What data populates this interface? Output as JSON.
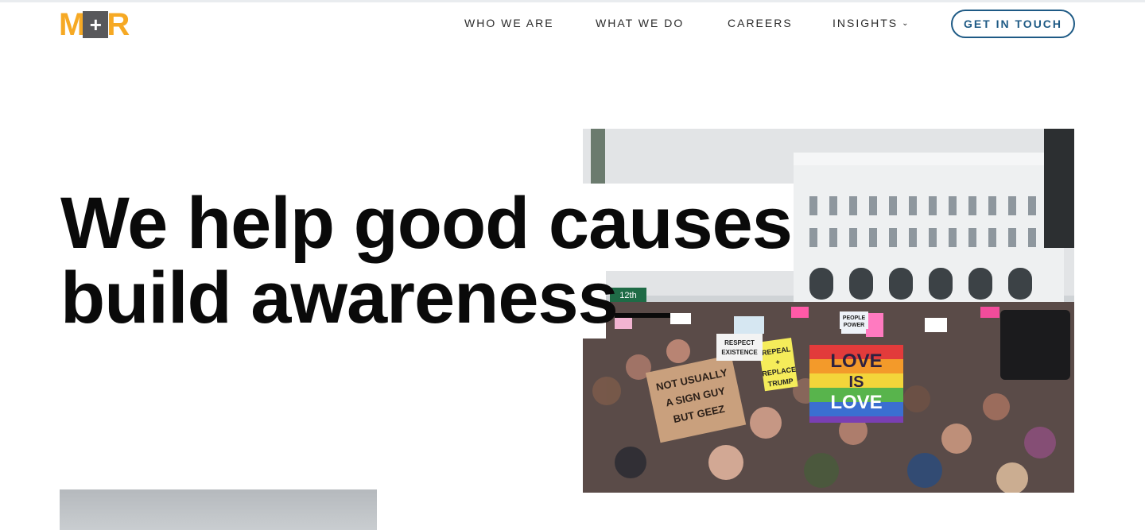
{
  "brand": {
    "logo_left": "M",
    "logo_plus": "+",
    "logo_right": "R",
    "accent": "#f6a924",
    "logo_box": "#58585b"
  },
  "nav": {
    "items": [
      {
        "label": "WHO WE ARE"
      },
      {
        "label": "WHAT WE DO"
      },
      {
        "label": "CAREERS"
      },
      {
        "label": "INSIGHTS"
      }
    ],
    "insights_chevron": "chevron-down-icon",
    "cta_label": "GET IN TOUCH",
    "cta_color": "#1e5a85"
  },
  "hero": {
    "line1": "We help good causes",
    "line2": "build awareness",
    "photo_signs": {
      "sign1": "NOT USUALLY A SIGN GUY BUT GEEZ",
      "sign2": "LOVE IS LOVE",
      "sign3": "REPEAL + REPLACE TRUMP",
      "sign4": "RESPECT EXISTENCE OR EXPECT RESISTANCE",
      "sign5": "PEOPLE POWER",
      "street": "12th"
    }
  }
}
